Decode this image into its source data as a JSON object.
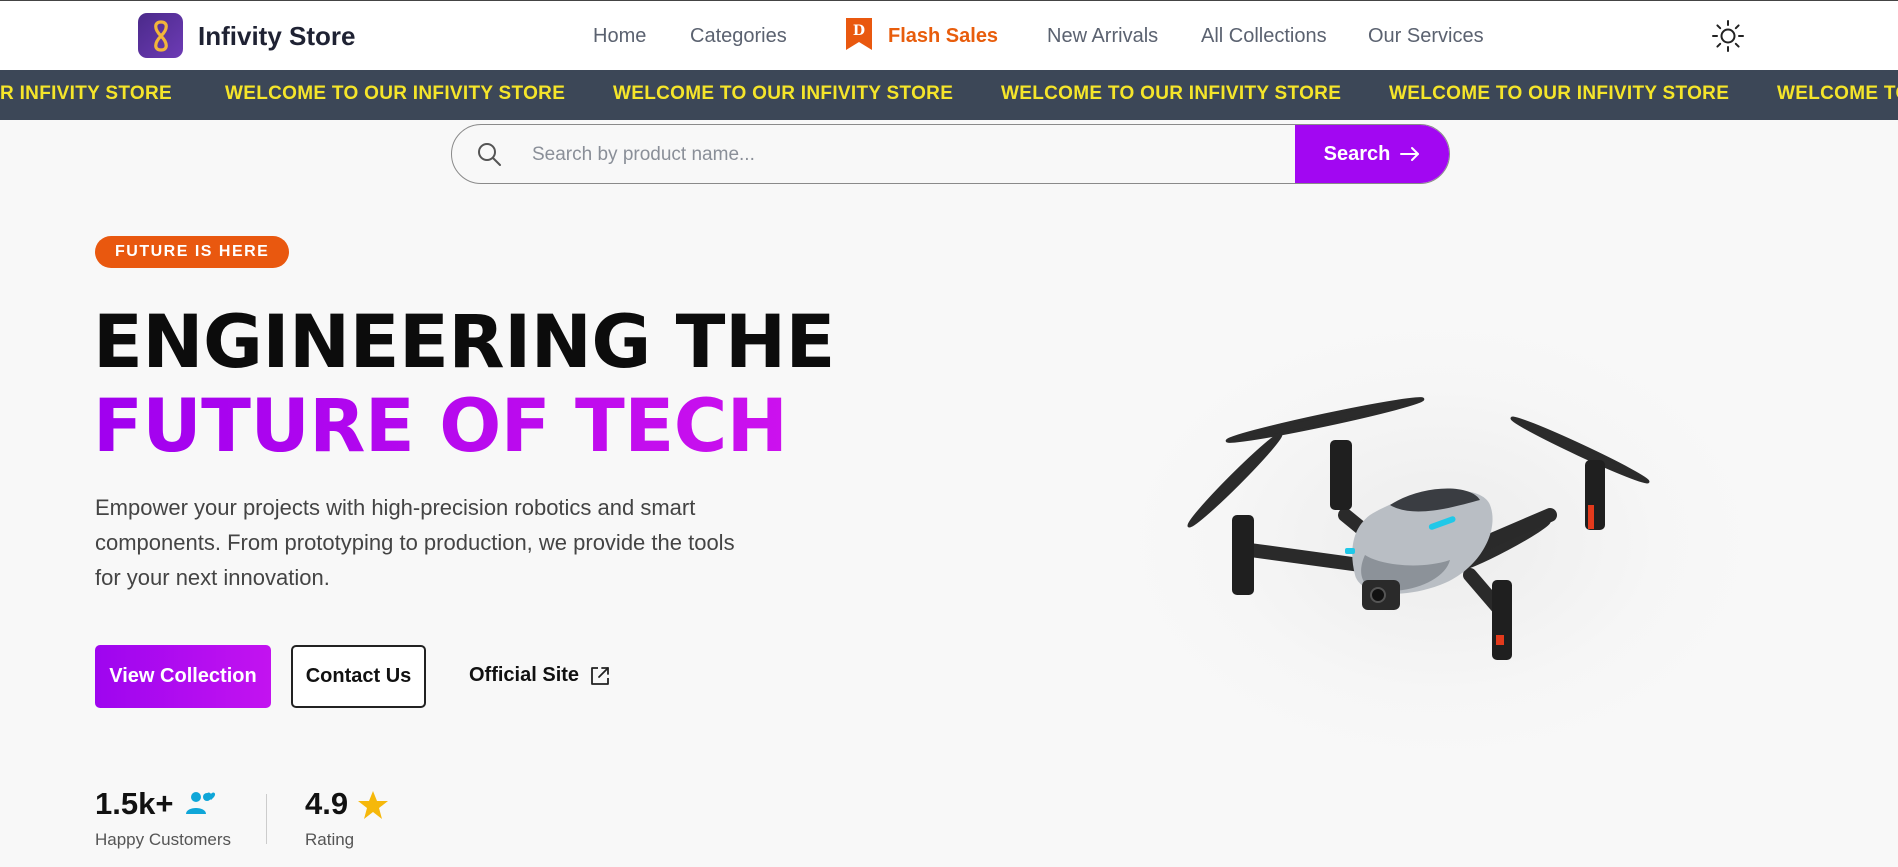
{
  "header": {
    "brand": "Infivity Store",
    "nav": [
      "Home",
      "Categories",
      "Flash Sales",
      "New Arrivals",
      "All Collections",
      "Our Services"
    ],
    "flash_badge_letter": "D"
  },
  "marquee": {
    "items": [
      "R INFIVITY STORE",
      "WELCOME TO OUR INFIVITY STORE",
      "WELCOME TO OUR INFIVITY STORE",
      "WELCOME TO OUR INFIVITY STORE",
      "WELCOME TO OUR INFIVITY STORE",
      "WELCOME TO"
    ]
  },
  "search": {
    "placeholder": "Search by product name...",
    "button_label": "Search"
  },
  "hero": {
    "badge": "FUTURE IS HERE",
    "title_line1": "ENGINEERING THE",
    "title_line2": "FUTURE OF TECH",
    "description": "Empower your projects with high-precision robotics and smart components. From prototyping to production, we provide the tools for your next innovation.",
    "primary_button": "View Collection",
    "secondary_button": "Contact Us",
    "link": "Official Site"
  },
  "stats": [
    {
      "value": "1.5k+",
      "label": "Happy Customers",
      "icon": "users-icon"
    },
    {
      "value": "4.9",
      "label": "Rating",
      "icon": "star-icon"
    }
  ],
  "colors": {
    "accent": "#a207f2",
    "orange": "#e9580f",
    "marquee_bg": "#3c4757",
    "marquee_text": "#f5e52a"
  }
}
